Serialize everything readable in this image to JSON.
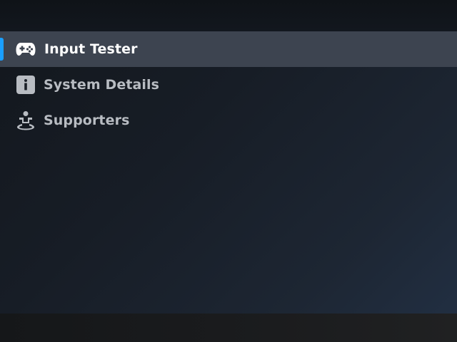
{
  "menu": {
    "items": [
      {
        "label": "Input Tester",
        "icon": "gamepad-icon",
        "selected": true
      },
      {
        "label": "System Details",
        "icon": "info-icon",
        "selected": false
      },
      {
        "label": "Supporters",
        "icon": "person-icon",
        "selected": false
      }
    ]
  },
  "colors": {
    "accent": "#1a9fff",
    "selected_bg": "#3d4450",
    "label_selected": "#ffffff",
    "label_default": "#b8bcc2"
  }
}
